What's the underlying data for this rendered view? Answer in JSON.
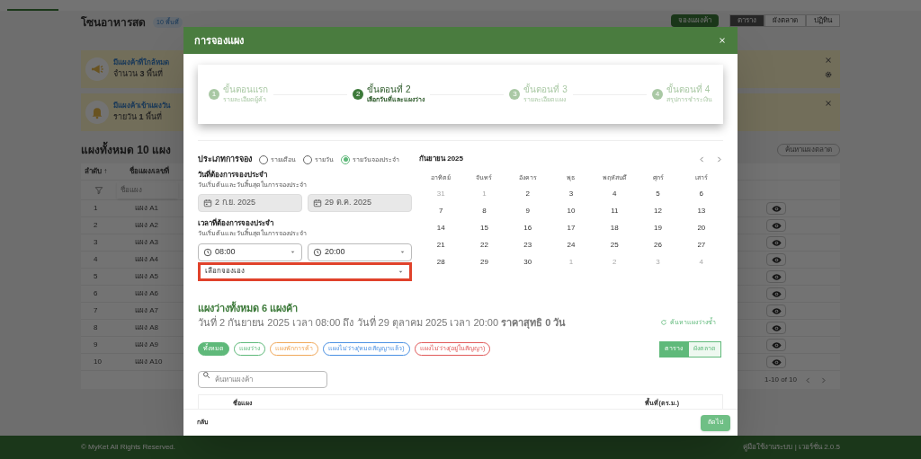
{
  "page": {
    "title": "โซนอาหารสด",
    "badge": "10 พื้นที่",
    "action_button": "จองแผงค้า",
    "views": [
      {
        "label": "ตาราง",
        "selected": true
      },
      {
        "label": "ผังตลาด",
        "selected": false
      },
      {
        "label": "ปฏิทิน",
        "selected": false
      }
    ],
    "banners": [
      {
        "title": "มีแผงค้าที่ใกล้หมด",
        "text": "จำนวน **3** พื้นที่",
        "kind": "megaphone"
      },
      {
        "title": "มีแผงค้าเข้าแผงวัน",
        "text": "รายวัน **1** พื้นที่",
        "kind": "bell"
      }
    ],
    "heading": "แผงทั้งหมด 10 แผง",
    "search_link": "ค้นหาแผงตลาด",
    "table": {
      "columns": [
        "ลำดับ ↑",
        "ชื่อแผง/เลขที่"
      ],
      "filter_placeholder": "ชื่อแผง",
      "rows": [
        [
          "1",
          "แผง A1"
        ],
        [
          "2",
          "แผง A2"
        ],
        [
          "3",
          "แผง A3"
        ],
        [
          "4",
          "แผง A4"
        ],
        [
          "5",
          "แผง A5"
        ],
        [
          "6",
          "แผง A6"
        ],
        [
          "7",
          "แผง A7"
        ],
        [
          "8",
          "แผง A8"
        ],
        [
          "9",
          "แผง A9"
        ],
        [
          "10",
          "แผง A10"
        ]
      ],
      "pagination": "1-10 of 10"
    },
    "footer": {
      "copyright": "© MyKet All Rights Reserved.",
      "links": "คู่มือใช้งานระบบ | เวอร์ชั่น 2.0.5"
    }
  },
  "modal": {
    "title": "การจองแผง",
    "steps": [
      {
        "number": "1",
        "title": "ขั้นตอนแรก",
        "subtitle": "รายละเอียดผู้ค้า",
        "active": false
      },
      {
        "number": "2",
        "title": "ขั้นตอนที่ 2",
        "subtitle": "เลือกวันที่และแผงว่าง",
        "active": true
      },
      {
        "number": "3",
        "title": "ขั้นตอนที่ 3",
        "subtitle": "รายละเอียดแผง",
        "active": false
      },
      {
        "number": "4",
        "title": "ขั้นตอนที่ 4",
        "subtitle": "สรุปการชำระเงิน",
        "active": false
      }
    ],
    "booking_type": {
      "label": "ประเภทการจอง",
      "options": [
        {
          "label": "รายเดือน",
          "selected": false
        },
        {
          "label": "รายวัน",
          "selected": false
        },
        {
          "label": "รายวันจองประจำ",
          "selected": true
        }
      ]
    },
    "dates": {
      "label": "วันที่ต้องการจองประจำ",
      "hint": "วันเริ่มต้นและวันสิ้นสุดในการจองประจำ",
      "start": "2 ก.ย. 2025",
      "end": "29 ต.ค. 2025"
    },
    "times": {
      "label": "เวลาที่ต้องการจองประจำ",
      "hint": "วันเริ่มต้นและวันสิ้นสุดในการจองประจำ",
      "start": "08:00",
      "end": "20:00",
      "mode": "เลือกจองเอง"
    },
    "calendar": {
      "month": "กันยายน 2025",
      "weekdays": [
        "อาทิตย์",
        "จันทร์",
        "อังคาร",
        "พุธ",
        "พฤหัสบดี",
        "ศุกร์",
        "เสาร์"
      ],
      "weeks": [
        [
          {
            "day": "31",
            "outside": true
          },
          {
            "day": "1",
            "outside": true
          },
          {
            "day": "2",
            "outside": false
          },
          {
            "day": "3",
            "outside": false
          },
          {
            "day": "4",
            "outside": false
          },
          {
            "day": "5",
            "outside": false
          },
          {
            "day": "6",
            "outside": false
          }
        ],
        [
          {
            "day": "7",
            "outside": false
          },
          {
            "day": "8",
            "outside": false
          },
          {
            "day": "9",
            "outside": false
          },
          {
            "day": "10",
            "outside": false
          },
          {
            "day": "11",
            "outside": false
          },
          {
            "day": "12",
            "outside": false
          },
          {
            "day": "13",
            "outside": false
          }
        ],
        [
          {
            "day": "14",
            "outside": false
          },
          {
            "day": "15",
            "outside": false
          },
          {
            "day": "16",
            "outside": false
          },
          {
            "day": "17",
            "outside": false
          },
          {
            "day": "18",
            "outside": false
          },
          {
            "day": "19",
            "outside": false
          },
          {
            "day": "20",
            "outside": false
          }
        ],
        [
          {
            "day": "21",
            "outside": false
          },
          {
            "day": "22",
            "outside": false
          },
          {
            "day": "23",
            "outside": false
          },
          {
            "day": "24",
            "outside": false
          },
          {
            "day": "25",
            "outside": false
          },
          {
            "day": "26",
            "outside": false
          },
          {
            "day": "27",
            "outside": false
          }
        ],
        [
          {
            "day": "28",
            "outside": false
          },
          {
            "day": "29",
            "outside": false
          },
          {
            "day": "30",
            "outside": false
          },
          {
            "day": "1",
            "outside": true
          },
          {
            "day": "2",
            "outside": true
          },
          {
            "day": "3",
            "outside": true
          },
          {
            "day": "4",
            "outside": true
          }
        ]
      ]
    },
    "results": {
      "title": "แผงว่างทั้งหมด 6 แผงค้า",
      "summary": "วันที่ 2 กันยายน 2025 เวลา 08:00 ถึง วันที่ 29 ตุลาคม 2025 เวลา 20:00 **ราคาสุทธิ 0 วัน**",
      "refresh": "ค้นหาแผงว่างซ้ำ",
      "filters": [
        {
          "label": "ทั้งหมด",
          "color": "#5fb97a",
          "selected": true
        },
        {
          "label": "แผงว่าง",
          "color": "#5fb97a",
          "selected": false
        },
        {
          "label": "แผงพักการค้า",
          "color": "#f0a85a",
          "selected": false
        },
        {
          "label": "แผงไม่ว่าง(หมดสัญญาแล้ว)",
          "color": "#4a90e2",
          "selected": false
        },
        {
          "label": "แผงไม่ว่าง(อยู่ในสัญญา)",
          "color": "#e05a5a",
          "selected": false
        }
      ],
      "views": [
        {
          "label": "ตาราง",
          "selected": true
        },
        {
          "label": "ผังตลาด",
          "selected": false
        }
      ],
      "search_placeholder": "ค้นหาแผงค้า",
      "columns": [
        "ชื่อแผง",
        "พื้นที่(ตร.ม.)"
      ]
    },
    "back": "กลับ",
    "next": "ถัดไป"
  }
}
